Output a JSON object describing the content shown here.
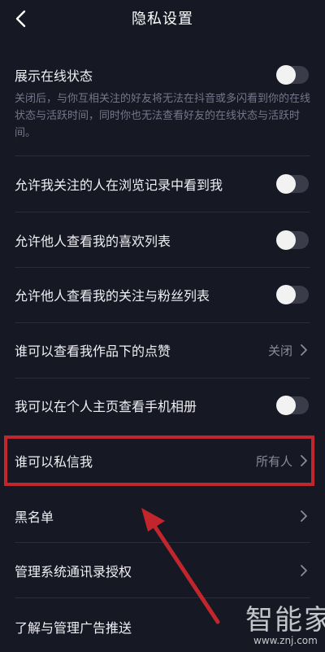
{
  "header": {
    "title": "隐私设置"
  },
  "online_status": {
    "label": "展示在线状态",
    "description": "关闭后，与你互相关注的好友将无法在抖音或多闪看到你的在线状态与活跃时间，同时你也无法查看好友的在线状态与活跃时间。",
    "enabled": false
  },
  "settings": [
    {
      "label": "允许我关注的人在浏览记录中看到我",
      "type": "toggle",
      "enabled": false
    },
    {
      "label": "允许他人查看我的喜欢列表",
      "type": "toggle",
      "enabled": false
    },
    {
      "label": "允许他人查看我的关注与粉丝列表",
      "type": "toggle",
      "enabled": false
    },
    {
      "label": "谁可以查看我作品下的点赞",
      "type": "select",
      "value": "关闭"
    },
    {
      "label": "我可以在个人主页查看手机相册",
      "type": "toggle",
      "enabled": false
    },
    {
      "label": "谁可以私信我",
      "type": "select",
      "value": "所有人"
    },
    {
      "label": "黑名单",
      "type": "link"
    },
    {
      "label": "管理系统通讯录授权",
      "type": "link"
    },
    {
      "label": "了解与管理广告推送",
      "type": "link"
    }
  ],
  "annotation": {
    "highlight_color": "#c2262d"
  },
  "watermark": {
    "text": "智能家",
    "url": "www.znj.com"
  }
}
